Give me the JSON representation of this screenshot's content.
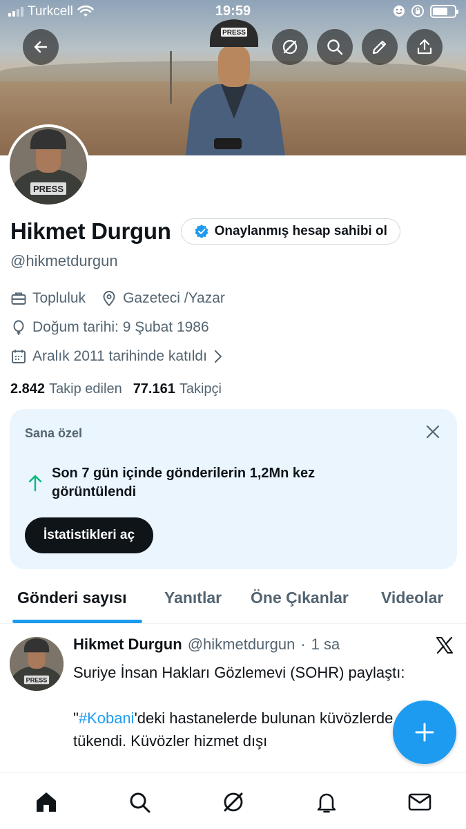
{
  "status_bar": {
    "carrier": "Turkcell",
    "time": "19:59"
  },
  "banner": {
    "press_label": "PRESS"
  },
  "profile": {
    "name": "Hikmet Durgun",
    "verify_button": "Onaylanmış hesap sahibi ol",
    "handle": "@hikmetdurgun",
    "category": "Topluluk",
    "location": "Gazeteci /Yazar",
    "birthday": "Doğum tarihi: 9 Şubat 1986",
    "joined": "Aralık 2011 tarihinde katıldı",
    "following_count": "2.842",
    "following_label": "Takip edilen",
    "followers_count": "77.161",
    "followers_label": "Takipçi"
  },
  "insight_card": {
    "label": "Sana özel",
    "message": "Son 7 gün içinde gönderilerin 1,2Mn kez görüntülendi",
    "button": "İstatistikleri aç"
  },
  "tabs": [
    {
      "label": "Gönderi sayısı",
      "active": true
    },
    {
      "label": "Yanıtlar",
      "active": false
    },
    {
      "label": "Öne Çıkanlar",
      "active": false
    },
    {
      "label": "Videolar",
      "active": false
    }
  ],
  "tweet": {
    "name": "Hikmet Durgun",
    "handle": "@hikmetdurgun",
    "sep": "·",
    "time": "1 sa",
    "line1": "Suriye İnsan Hakları Gözlemevi (SOHR) paylaştı:",
    "quote_open": "\"",
    "hashtag": "#Kobani",
    "line2": "'deki hastanelerde bulunan küvözlerde oksijen tükendi. Küvözler hizmet dışı"
  },
  "icons": {
    "colors": {
      "accent": "#1d9bf0",
      "text": "#0f1419",
      "muted": "#536471",
      "card_bg": "#eaf5fd",
      "success": "#00ba7c"
    }
  }
}
